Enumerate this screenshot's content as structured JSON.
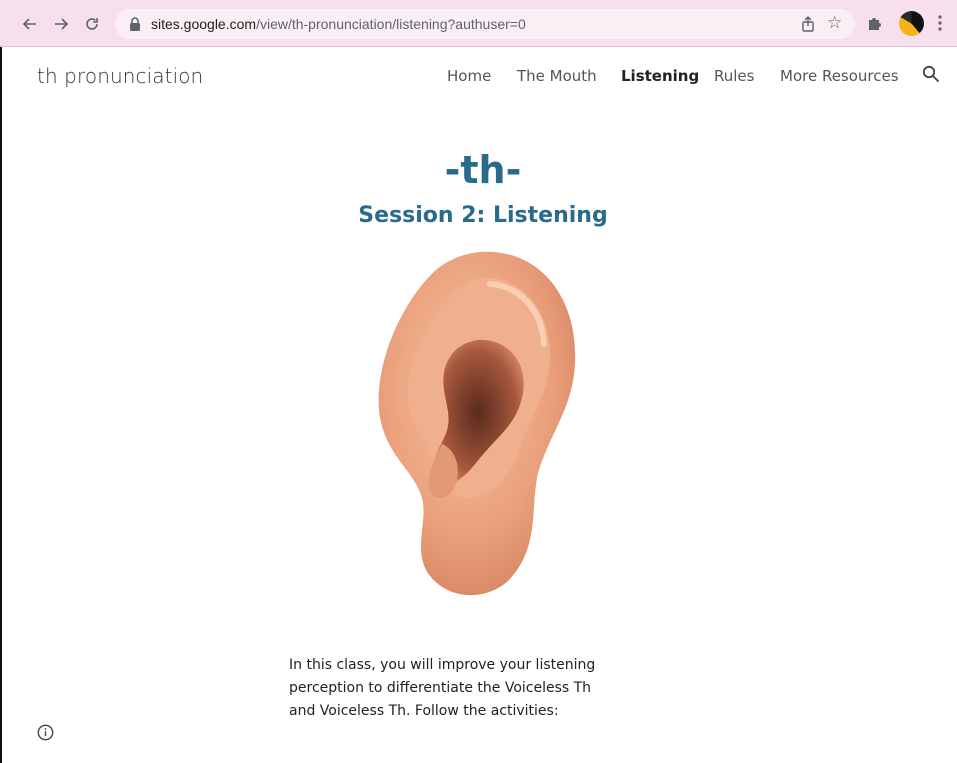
{
  "browser": {
    "url_host": "sites.google.com",
    "url_path": "/view/th-pronunciation/listening?authuser=0"
  },
  "site": {
    "title": "th pronunciation",
    "nav": [
      {
        "label": "Home",
        "active": false
      },
      {
        "label": "The Mouth",
        "active": false
      },
      {
        "label": "Listening",
        "active": true
      },
      {
        "label": "Rules",
        "active": false
      },
      {
        "label": "More Resources",
        "active": false
      }
    ]
  },
  "hero": {
    "title": "-th-",
    "subtitle": "Session 2: Listening"
  },
  "body": {
    "paragraph": "In this class, you will improve your listening perception to differentiate the Voiceless Th and Voiceless Th.  Follow the activities:"
  },
  "icons": {
    "back": "arrow-left-icon",
    "forward": "arrow-right-icon",
    "reload": "reload-icon",
    "lock": "lock-icon",
    "share": "share-icon",
    "star": "star-icon",
    "extensions": "puzzle-icon",
    "menu": "kebab-menu-icon",
    "search": "search-icon",
    "info": "info-icon"
  },
  "colors": {
    "heading": "#2a6b8c",
    "browser_bar": "#f7dfee"
  }
}
